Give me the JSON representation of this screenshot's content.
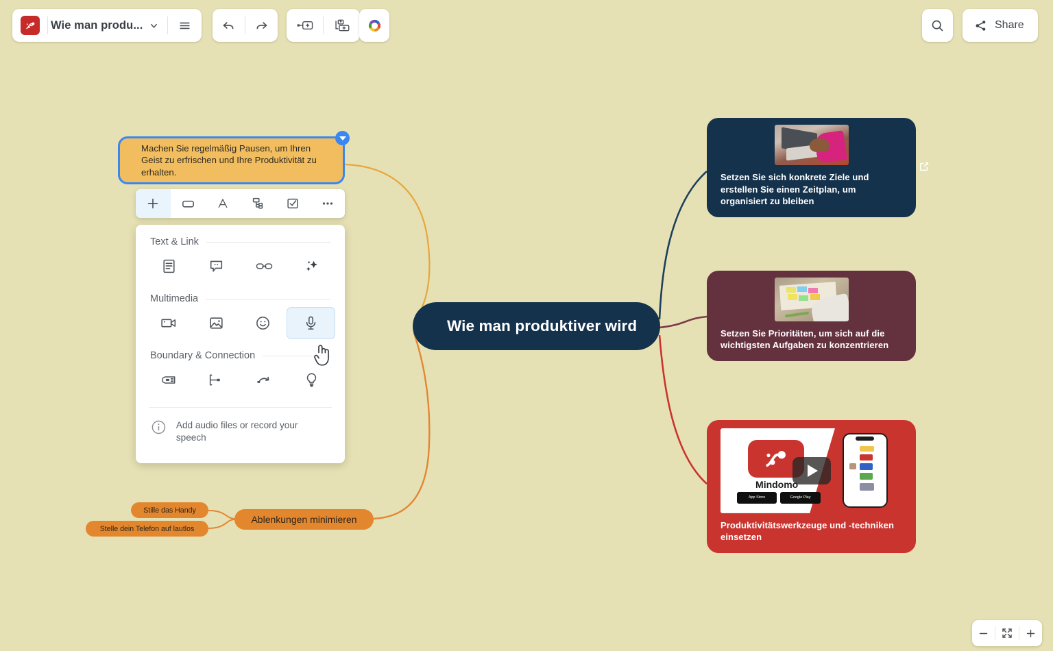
{
  "app": {
    "logo_icon": "mindomo-logo-icon",
    "doc_title": "Wie man produ...",
    "chevron_icon": "chevron-down-icon",
    "menu_icon": "hamburger-menu-icon"
  },
  "toolbar": {
    "undo_icon": "undo-icon",
    "redo_icon": "redo-icon",
    "add_topic_icon": "add-topic-icon",
    "add_subtopic_icon": "add-subtopic-icon",
    "theme_icon": "color-theme-wheel-icon",
    "search_icon": "search-icon",
    "share_icon": "share-icon",
    "share_label": "Share"
  },
  "map": {
    "central_topic": "Wie man produktiver wird",
    "selected_note": "Machen Sie regelmäßig Pausen, um Ihren Geist zu erfrischen und Ihre Produktivität zu erhalten.",
    "collapse_handle_icon": "collapse-triangle-icon",
    "external_link_icon": "external-link-icon",
    "branches": [
      {
        "name": "distractions",
        "label": "Ablenkungen minimieren"
      },
      {
        "name": "silence-phone",
        "label": "Stille das Handy"
      },
      {
        "name": "phone-silent",
        "label": "Stelle dein Telefon auf lautlos"
      }
    ],
    "cards": [
      {
        "name": "goals",
        "label": "Setzen Sie sich konkrete Ziele und erstellen Sie einen Zeitplan, um organisiert zu bleiben",
        "color": "#15324d",
        "thumb": "woman-typing-on-laptop-photo"
      },
      {
        "name": "priorities",
        "label": "Setzen Sie Prioritäten, um sich auf die wichtigsten Aufgaben zu konzentrieren",
        "color": "#64313f",
        "thumb": "planner-with-sticky-notes-photo"
      },
      {
        "name": "tools",
        "label": "Produktivitätswerkzeuge und -techniken einsetzen",
        "color": "#c9342f",
        "thumb": "mindomo-app-video-thumbnail",
        "video_brand": "Mindomo",
        "store_badges": [
          "App Store",
          "Google Play"
        ],
        "play_icon": "play-button-icon"
      }
    ],
    "connector_colors": {
      "note": "#e8a63c",
      "branch": "#e3872f",
      "goals": "#1d3f5e",
      "priorities": "#7b3a49",
      "tools": "#c9342f"
    }
  },
  "context_toolbar": {
    "items": [
      {
        "name": "insert",
        "icon": "plus-icon",
        "active": true
      },
      {
        "name": "shape",
        "icon": "rounded-rectangle-icon",
        "active": false
      },
      {
        "name": "text-format",
        "icon": "letter-a-icon",
        "active": false
      },
      {
        "name": "layout",
        "icon": "topic-layout-icon",
        "active": false
      },
      {
        "name": "task",
        "icon": "checkbox-icon",
        "active": false
      },
      {
        "name": "more",
        "icon": "ellipsis-icon",
        "active": false
      }
    ]
  },
  "insert_panel": {
    "sections": [
      {
        "name": "text-link",
        "title": "Text & Link",
        "items": [
          {
            "name": "note",
            "icon": "note-document-icon"
          },
          {
            "name": "comment",
            "icon": "comment-bubble-icon"
          },
          {
            "name": "hyperlink",
            "icon": "link-chain-icon"
          },
          {
            "name": "ai-assist",
            "icon": "sparkles-ai-icon"
          }
        ]
      },
      {
        "name": "multimedia",
        "title": "Multimedia",
        "items": [
          {
            "name": "video",
            "icon": "video-camera-icon"
          },
          {
            "name": "image",
            "icon": "image-picture-icon"
          },
          {
            "name": "emoji",
            "icon": "smiley-face-icon"
          },
          {
            "name": "audio",
            "icon": "microphone-icon",
            "highlight": true
          }
        ]
      },
      {
        "name": "boundary-connection",
        "title": "Boundary & Connection",
        "items": [
          {
            "name": "summary",
            "icon": "summary-bracket-icon"
          },
          {
            "name": "boundary",
            "icon": "boundary-icon"
          },
          {
            "name": "relationship",
            "icon": "relationship-arrow-icon"
          },
          {
            "name": "idea",
            "icon": "lightbulb-icon"
          }
        ]
      }
    ],
    "hint_icon": "info-circle-icon",
    "hint_text": "Add audio files or record your speech"
  },
  "zoom_controls": {
    "zoom_out_icon": "minus-icon",
    "fit_icon": "fit-to-screen-icon",
    "zoom_in_icon": "plus-icon"
  }
}
